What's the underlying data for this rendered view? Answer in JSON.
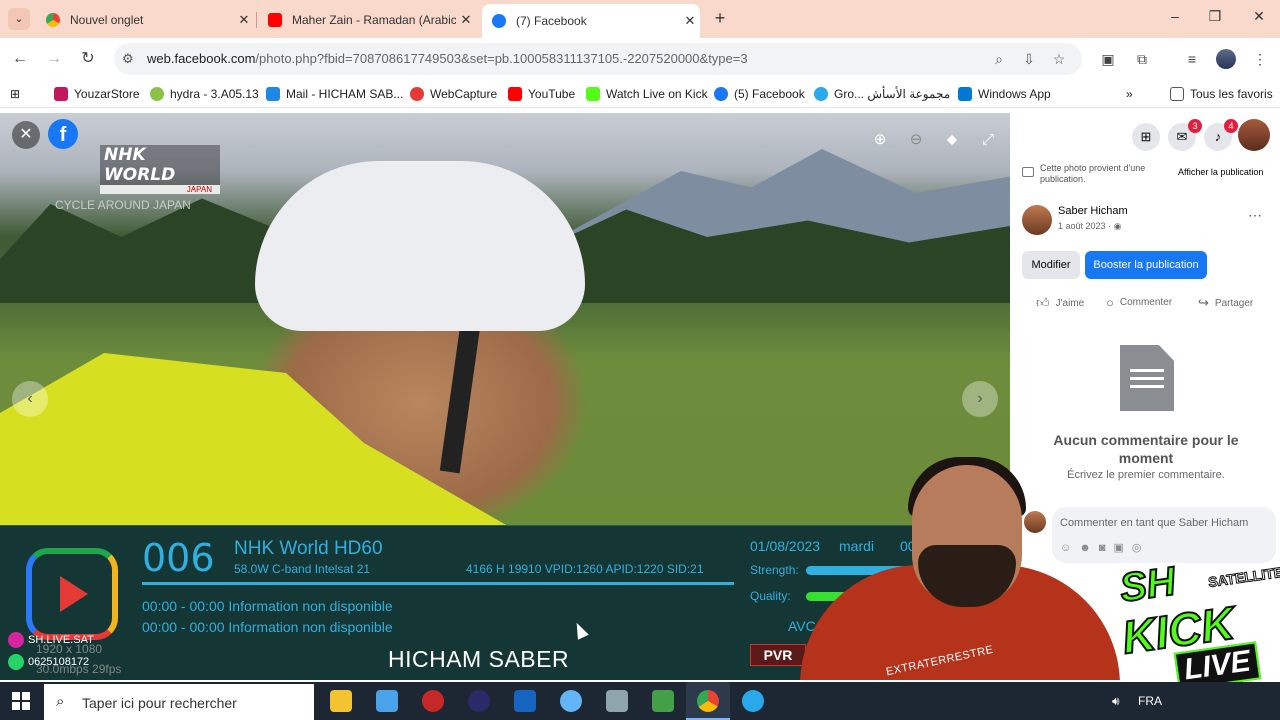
{
  "browser": {
    "tabs": [
      {
        "title": "Nouvel onglet",
        "icon": "chrome-icon",
        "color": "#4285f4",
        "active": false
      },
      {
        "title": "Maher Zain - Ramadan (Arabic)",
        "icon": "youtube-icon",
        "color": "#ff0000",
        "active": false
      },
      {
        "title": "(7) Facebook",
        "icon": "facebook-icon",
        "color": "#1877f2",
        "active": true
      }
    ],
    "url_prefix": "web.facebook.com",
    "url_rest": "/photo.php?fbid=708708617749503&set=pb.100058311137105.-2207520000&type=3",
    "bookmarks": [
      {
        "label": "YouzarStore",
        "color": "#c2185b"
      },
      {
        "label": "hydra - 3.A05.13",
        "color": "#8bc34a"
      },
      {
        "label": "Mail - HICHAM SAB...",
        "color": "#1e88e5"
      },
      {
        "label": "WebCapture",
        "color": "#e53935"
      },
      {
        "label": "YouTube",
        "color": "#ff0000"
      },
      {
        "label": "Watch Live on Kick",
        "color": "#53fc18"
      },
      {
        "label": "(5) Facebook",
        "color": "#1877f2"
      },
      {
        "label": "Gro... مجموعة الأسأش",
        "color": "#29a9eb"
      },
      {
        "label": "Windows App",
        "color": "#0078d4"
      }
    ],
    "all_bookmarks": "Tous les favoris"
  },
  "viewer": {
    "overlay_logo": "NHK WORLD",
    "overlay_logo_sub": "JAPAN",
    "overlay_program": "CYCLE AROUND JAPAN",
    "infobar": {
      "channel_number": "006",
      "channel_name": "NHK World HD60",
      "satellite": "58.0W C-band Intelsat 21",
      "tech": "4166 H 19910   VPID:1260 APID:1220 SID:21",
      "epg_now": "00:00 - 00:00 Information non disponible",
      "epg_next": "00:00 - 00:00 Information non disponible",
      "date": "01/08/2023",
      "day": "mardi",
      "time": "00",
      "strength_label": "Strength:",
      "quality_label": "Quality:",
      "strength_value": 0.85,
      "quality_value": 0.45,
      "codec": "AVC",
      "pvr": "PVR",
      "caption": "HICHAM SABER",
      "watermark_insta": "SH.LIVE.SAT",
      "watermark_phone": "0625108172",
      "resolution": "1920 x 1080",
      "fps": "30.0mbps 29fps"
    }
  },
  "facebook": {
    "notif_messenger": "3",
    "notif_bell": "4",
    "source_text": "Cette photo provient d'une publication.",
    "view_post": "Afficher la publication",
    "author": "Saber Hicham",
    "date": "1 août 2023 ·",
    "edit": "Modifier",
    "boost": "Booster la publication",
    "like": "J'aime",
    "comment": "Commenter",
    "share": "Partager",
    "no_comments": "Aucun commentaire pour le moment",
    "first_comment": "Écrivez le premier commentaire.",
    "comment_placeholder": "Commenter en tant que Saber Hicham"
  },
  "overlay": {
    "shirt_text": "EXTRATERRESTRE",
    "kick_brand_top": "SH",
    "kick_brand_sub": "SATELLITE",
    "kick_word": "KICK",
    "kick_live": "LIVE"
  },
  "taskbar": {
    "search_placeholder": "Taper ici pour rechercher",
    "lang": "FRA",
    "volume_icon": "speaker-icon"
  }
}
